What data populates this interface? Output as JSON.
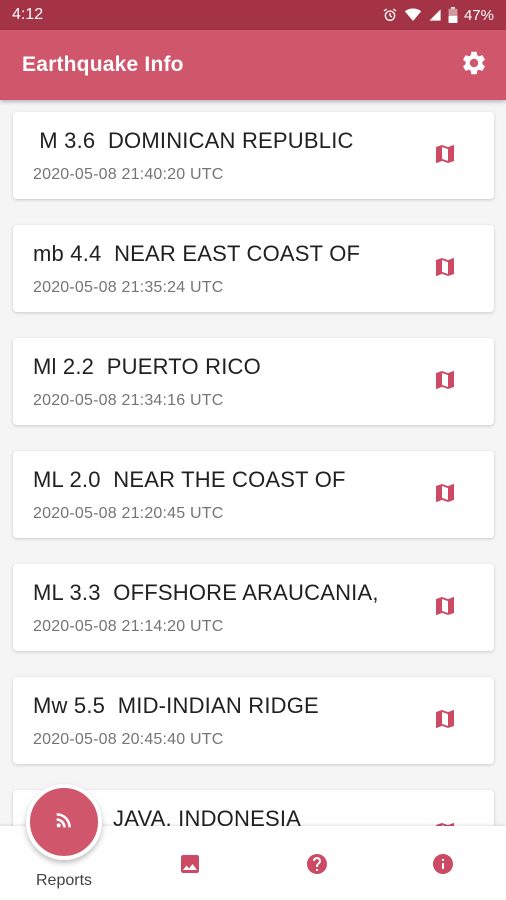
{
  "status_bar": {
    "time": "4:12",
    "battery": "47%",
    "icons": [
      "alarm-icon",
      "wifi-icon",
      "signal-icon",
      "battery-icon"
    ]
  },
  "app_bar": {
    "title": "Earthquake Info",
    "settings_icon": "gear-icon"
  },
  "quakes": [
    {
      "title": " M 3.6  DOMINICAN REPUBLIC",
      "time": "2020-05-08 21:40:20 UTC"
    },
    {
      "title": "mb 4.4  NEAR EAST COAST OF",
      "time": "2020-05-08 21:35:24 UTC"
    },
    {
      "title": "Ml 2.2  PUERTO RICO",
      "time": "2020-05-08 21:34:16 UTC"
    },
    {
      "title": "ML 2.0  NEAR THE COAST OF",
      "time": "2020-05-08 21:20:45 UTC"
    },
    {
      "title": "ML 3.3  OFFSHORE ARAUCANIA,",
      "time": "2020-05-08 21:14:20 UTC"
    },
    {
      "title": "Mw 5.5  MID-INDIAN RIDGE",
      "time": "2020-05-08 20:45:40 UTC"
    },
    {
      "title": "JAVA, INDONESIA",
      "time": ""
    }
  ],
  "bottom_nav": {
    "reports_label": "Reports",
    "items": [
      "rss-feed-icon",
      "image-icon",
      "help-icon",
      "info-icon"
    ]
  },
  "colors": {
    "primary": "#d0566c",
    "primary_dark": "#a53346",
    "accent_icon": "#cc4a64"
  }
}
